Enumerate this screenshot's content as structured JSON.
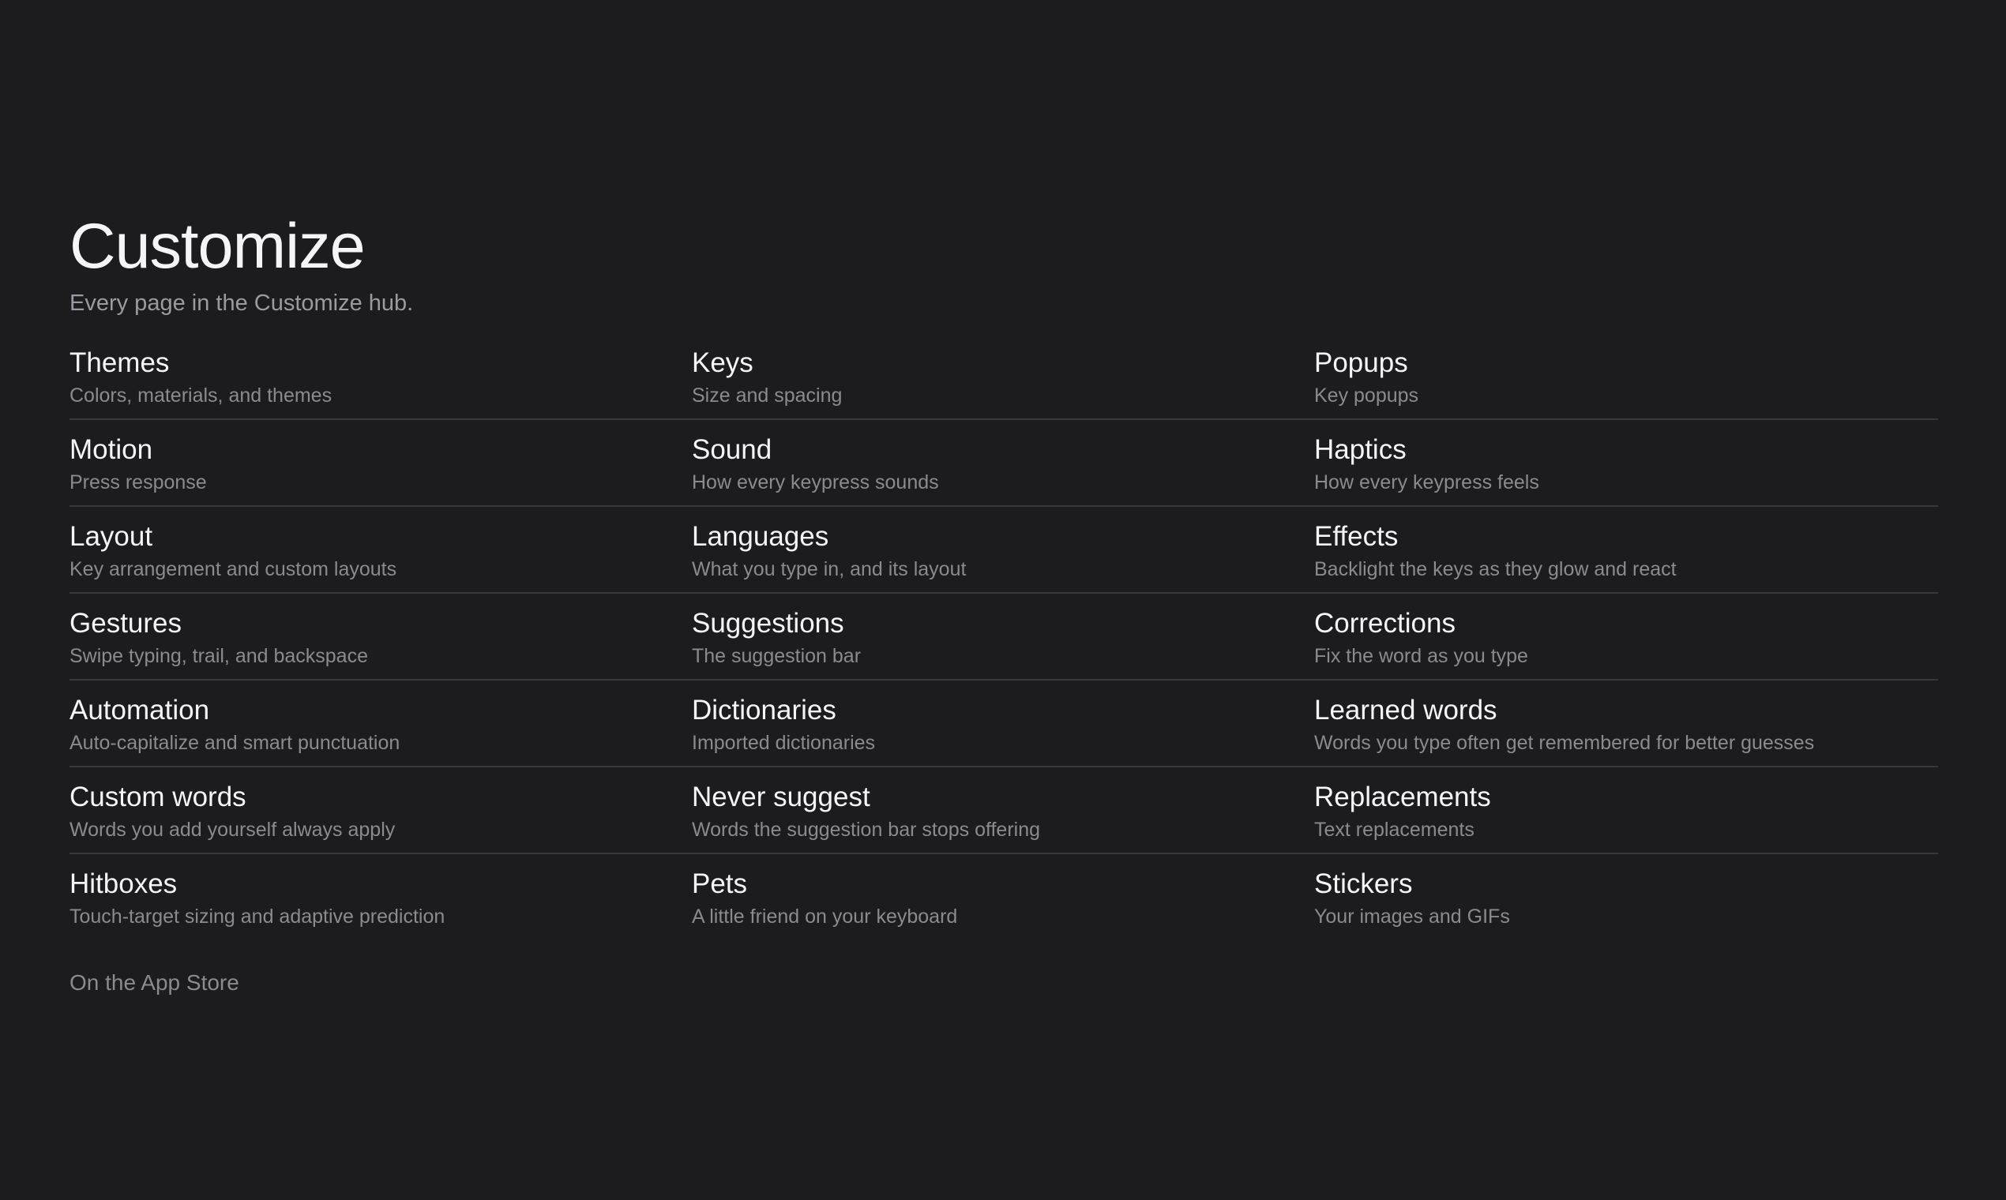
{
  "header": {
    "title": "Customize",
    "subtitle": "Every page in the Customize hub."
  },
  "items": [
    {
      "title": "Themes",
      "subtitle": "Colors, materials, and themes"
    },
    {
      "title": "Keys",
      "subtitle": "Size and spacing"
    },
    {
      "title": "Popups",
      "subtitle": "Key popups"
    },
    {
      "title": "Motion",
      "subtitle": "Press response"
    },
    {
      "title": "Sound",
      "subtitle": "How every keypress sounds"
    },
    {
      "title": "Haptics",
      "subtitle": "How every keypress feels"
    },
    {
      "title": "Layout",
      "subtitle": "Key arrangement and custom layouts"
    },
    {
      "title": "Languages",
      "subtitle": "What you type in, and its layout"
    },
    {
      "title": "Effects",
      "subtitle": "Backlight the keys as they glow and react"
    },
    {
      "title": "Gestures",
      "subtitle": "Swipe typing, trail, and backspace"
    },
    {
      "title": "Suggestions",
      "subtitle": "The suggestion bar"
    },
    {
      "title": "Corrections",
      "subtitle": "Fix the word as you type"
    },
    {
      "title": "Automation",
      "subtitle": "Auto-capitalize and smart punctuation"
    },
    {
      "title": "Dictionaries",
      "subtitle": "Imported dictionaries"
    },
    {
      "title": "Learned words",
      "subtitle": "Words you type often get remembered for better guesses"
    },
    {
      "title": "Custom words",
      "subtitle": "Words you add yourself always apply"
    },
    {
      "title": "Never suggest",
      "subtitle": "Words the suggestion bar stops offering"
    },
    {
      "title": "Replacements",
      "subtitle": "Text replacements"
    },
    {
      "title": "Hitboxes",
      "subtitle": "Touch-target sizing and adaptive prediction"
    },
    {
      "title": "Pets",
      "subtitle": "A little friend on your keyboard"
    },
    {
      "title": "Stickers",
      "subtitle": "Your images and GIFs"
    }
  ],
  "footer": {
    "app_store_label": "On the App Store"
  }
}
